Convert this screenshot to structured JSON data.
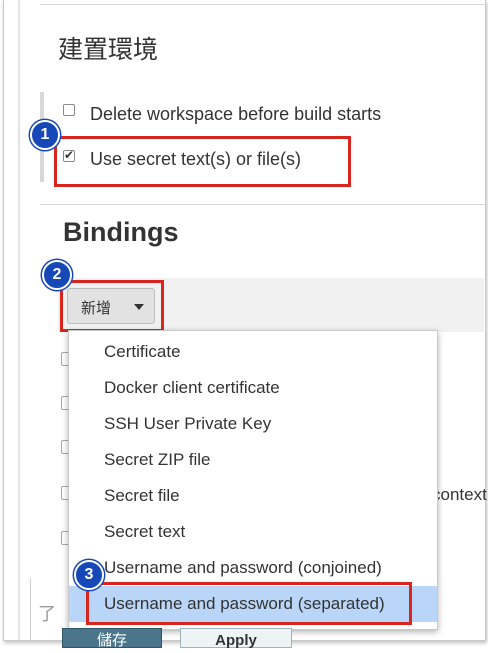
{
  "section": {
    "title": "建置環境"
  },
  "options": [
    {
      "label": "Delete workspace before build starts",
      "checked": false
    },
    {
      "label": "Use secret text(s) or file(s)",
      "checked": true
    }
  ],
  "bindings": {
    "title": "Bindings",
    "add_button_label": "新增"
  },
  "dropdown": {
    "items": [
      "Certificate",
      "Docker client certificate",
      "SSH User Private Key",
      "Secret ZIP file",
      "Secret file",
      "Secret text",
      "Username and password (conjoined)",
      "Username and password (separated)"
    ],
    "highlighted_index": 7
  },
  "background_fragment": "context",
  "footer": {
    "save_label": "儲存",
    "apply_label": "Apply",
    "partial_glyph": "了"
  },
  "annotations": [
    "1",
    "2",
    "3"
  ],
  "colors": {
    "annotation_red": "#d9251d",
    "badge_blue": "#1748b8",
    "highlight": "#b9d5f8",
    "save_button": "#4b758b"
  }
}
